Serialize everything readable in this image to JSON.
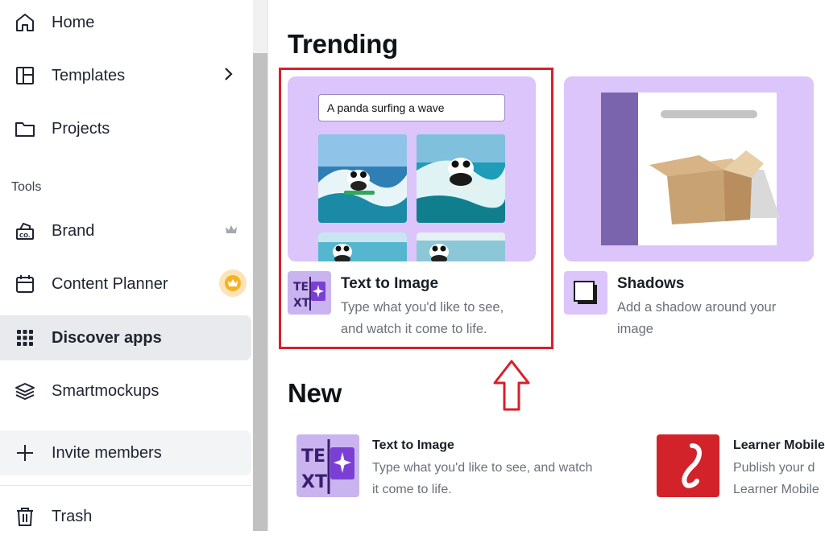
{
  "sidebar": {
    "items": [
      {
        "label": "Home",
        "icon": "home-icon"
      },
      {
        "label": "Templates",
        "icon": "templates-icon"
      },
      {
        "label": "Projects",
        "icon": "folder-icon"
      }
    ],
    "tools_label": "Tools",
    "tools": [
      {
        "label": "Brand",
        "icon": "brand-icon"
      },
      {
        "label": "Content Planner",
        "icon": "calendar-icon"
      },
      {
        "label": "Discover apps",
        "icon": "apps-grid-icon"
      },
      {
        "label": "Smartmockups",
        "icon": "layers-icon"
      }
    ],
    "invite_label": "Invite members",
    "trash_label": "Trash"
  },
  "trending": {
    "heading": "Trending",
    "cards": [
      {
        "title": "Text to Image",
        "description_line1": "Type what you'd like to see,",
        "description_line2": "and watch it come to life.",
        "prompt": "A panda surfing a wave"
      },
      {
        "title": "Shadows",
        "description_line1": "Add a shadow around your",
        "description_line2": "image"
      }
    ]
  },
  "new": {
    "heading": "New",
    "apps": [
      {
        "title": "Text to Image",
        "description_line1": "Type what you'd like to see, and watch",
        "description_line2": "it come to life."
      },
      {
        "title": "Learner Mobile",
        "description_line1": "Publish your d",
        "description_line2": "Learner Mobile"
      }
    ]
  },
  "colors": {
    "accent_purple": "#dbc5fb",
    "highlight_red": "#d6202b",
    "active_bg": "#e8eaed",
    "crown_badge": "#fde3b8",
    "learner_red": "#d3232a"
  }
}
